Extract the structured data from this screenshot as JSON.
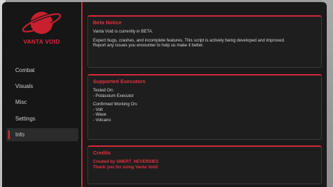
{
  "brand": {
    "name": "VANTA VOID",
    "logo_icon": "planet-ring-icon",
    "accent": "#d8283a"
  },
  "nav": {
    "items": [
      {
        "label": "Combat",
        "active": false
      },
      {
        "label": "Visuals",
        "active": false
      },
      {
        "label": "Misc",
        "active": false
      },
      {
        "label": "Settings",
        "active": false
      },
      {
        "label": "Info",
        "active": true
      }
    ]
  },
  "cards": {
    "beta": {
      "title": "Beta Notice",
      "line1": "Vanta Void is currently in BETA.",
      "line2": "Expect bugs, crashes, and incomplete features. This script is actively being developed and improved.",
      "line3": "Report any issues you encounter to help us make it better."
    },
    "executors": {
      "title": "Supported Executors",
      "tested_heading": "Tested On:",
      "tested": [
        "- Potassium Executor"
      ],
      "confirmed_heading": "Confirmed Working On:",
      "confirmed": [
        "- Volt",
        "- Wave",
        "- Volcano"
      ]
    },
    "credits": {
      "title": "Credits",
      "line1": "Created by SMERT_NEVERDIES",
      "line2": "Thank you for using Vanta Void!"
    }
  }
}
